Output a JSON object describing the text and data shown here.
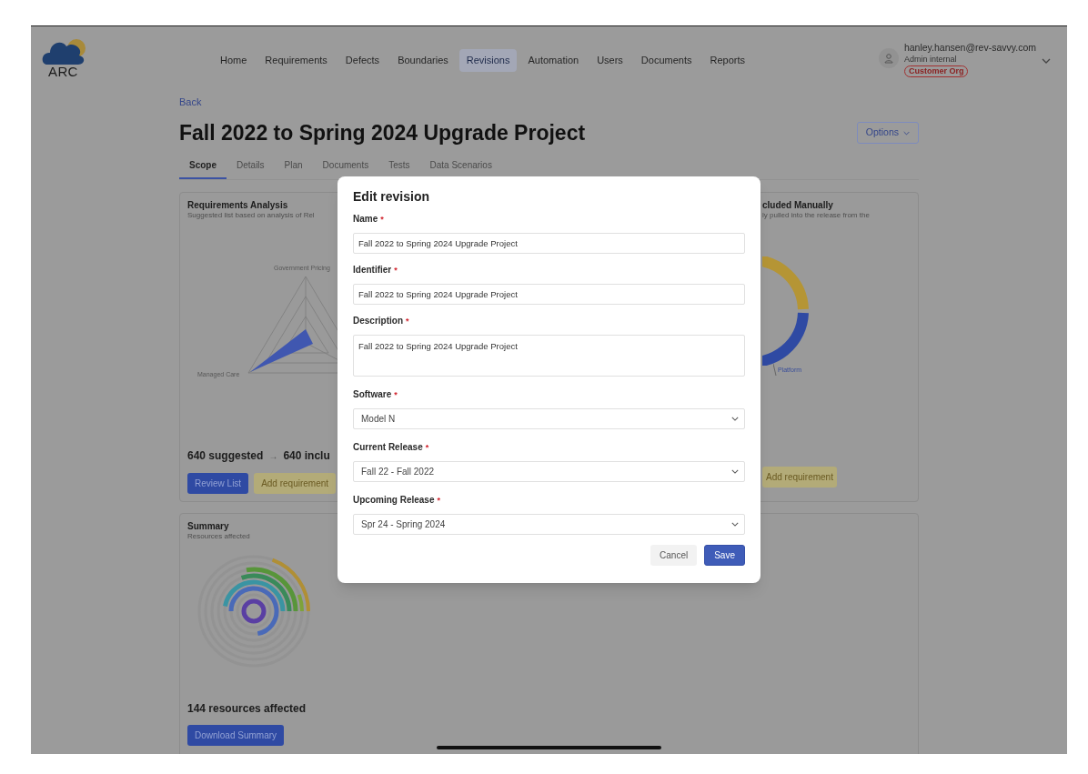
{
  "logo": {
    "text": "ARC"
  },
  "nav": [
    {
      "label": "Home",
      "selected": false
    },
    {
      "label": "Requirements",
      "selected": false
    },
    {
      "label": "Defects",
      "selected": false
    },
    {
      "label": "Boundaries",
      "selected": false
    },
    {
      "label": "Revisions",
      "selected": true
    },
    {
      "label": "Automation",
      "selected": false
    },
    {
      "label": "Users",
      "selected": false
    },
    {
      "label": "Documents",
      "selected": false
    },
    {
      "label": "Reports",
      "selected": false
    }
  ],
  "user": {
    "email": "hanley.hansen@rev-savvy.com",
    "role": "Admin internal",
    "org": "Customer Org"
  },
  "back": "Back",
  "title": "Fall 2022 to Spring 2024 Upgrade Project",
  "options_button": "Options",
  "tabs": [
    {
      "label": "Scope",
      "selected": true
    },
    {
      "label": "Details",
      "selected": false
    },
    {
      "label": "Plan",
      "selected": false
    },
    {
      "label": "Documents",
      "selected": false
    },
    {
      "label": "Tests",
      "selected": false
    },
    {
      "label": "Data Scenarios",
      "selected": false
    }
  ],
  "requirements_card": {
    "title": "Requirements Analysis",
    "subtitle": "Suggested list based on analysis of Rel",
    "chart_labels": [
      "Government Pricing",
      "Managed Care"
    ],
    "suggested": "640 suggested",
    "arrow": "→",
    "included": "640 inclu",
    "buttons": [
      "Review List",
      "Add requirement"
    ]
  },
  "manual_card": {
    "title": "cluded Manually",
    "subtitle": "ly pulled into the release from the",
    "chart_label": "Platform",
    "button": "Add requirement"
  },
  "summary_card": {
    "title": "Summary",
    "subtitle": "Resources affected",
    "total": "144 resources affected",
    "button": "Download Summary"
  },
  "dialog": {
    "title": "Edit revision",
    "fields": [
      {
        "kind": "text",
        "label": "Name",
        "mark": "*",
        "value": "Fall 2022 to Spring 2024 Upgrade Project"
      },
      {
        "kind": "text",
        "label": "Identifier",
        "mark": "*",
        "value": "Fall 2022 to Spring 2024 Upgrade Project"
      },
      {
        "kind": "textarea",
        "label": "Description",
        "mark": "*",
        "value": "Fall 2022 to Spring 2024 Upgrade Project"
      },
      {
        "kind": "select",
        "label": "Software",
        "mark": "*",
        "value": "Model N"
      },
      {
        "kind": "select",
        "label": "Current Release",
        "mark": "*",
        "value": "Fall 22 - Fall 2022"
      },
      {
        "kind": "select",
        "label": "Upcoming Release",
        "mark": "*",
        "value": "Spr 24 - Spring 2024"
      }
    ],
    "buttons": [
      {
        "kind": "secondary",
        "label": "Cancel"
      },
      {
        "kind": "primary",
        "label": "Save"
      }
    ]
  }
}
